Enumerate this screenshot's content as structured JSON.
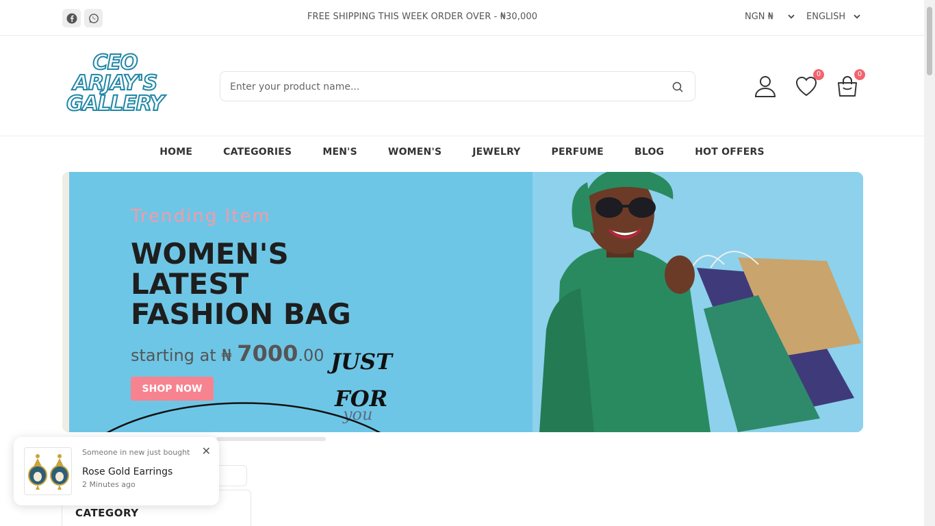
{
  "topbar": {
    "promo": "FREE SHIPPING THIS WEEK ORDER OVER - ₦30,000",
    "currency": "NGN ₦",
    "language": "ENGLISH",
    "social_icons": [
      "facebook-icon",
      "whatsapp-icon"
    ]
  },
  "header": {
    "logo_lines": [
      "CEO",
      "ARJAY'S",
      "GALLERY"
    ],
    "search_placeholder": "Enter your product name...",
    "wishlist_count": "0",
    "cart_count": "0"
  },
  "nav": {
    "items": [
      "HOME",
      "CATEGORIES",
      "MEN'S",
      "WOMEN'S",
      "JEWELRY",
      "PERFUME",
      "BLOG",
      "HOT OFFERS"
    ]
  },
  "hero": {
    "eyebrow": "Trending Item",
    "headline_lines": [
      "WOMEN'S",
      "LATEST",
      "FASHION BAG"
    ],
    "price_prefix": "starting at ₦ ",
    "price_main": "7000",
    "price_cents": ".00",
    "cta": "SHOP NOW",
    "script_lines": [
      "JUST",
      "FOR",
      "you"
    ]
  },
  "sidebar": {
    "category_title": "CATEGORY"
  },
  "toast": {
    "line1": "Someone in new just bought",
    "product": "Rose Gold Earrings",
    "time": "2 Minutes ago"
  },
  "colors": {
    "accent": "#f6838f",
    "hero_bg": "#6ec6e6",
    "badge": "#f2646e",
    "logo_outline": "#1f86a6"
  }
}
